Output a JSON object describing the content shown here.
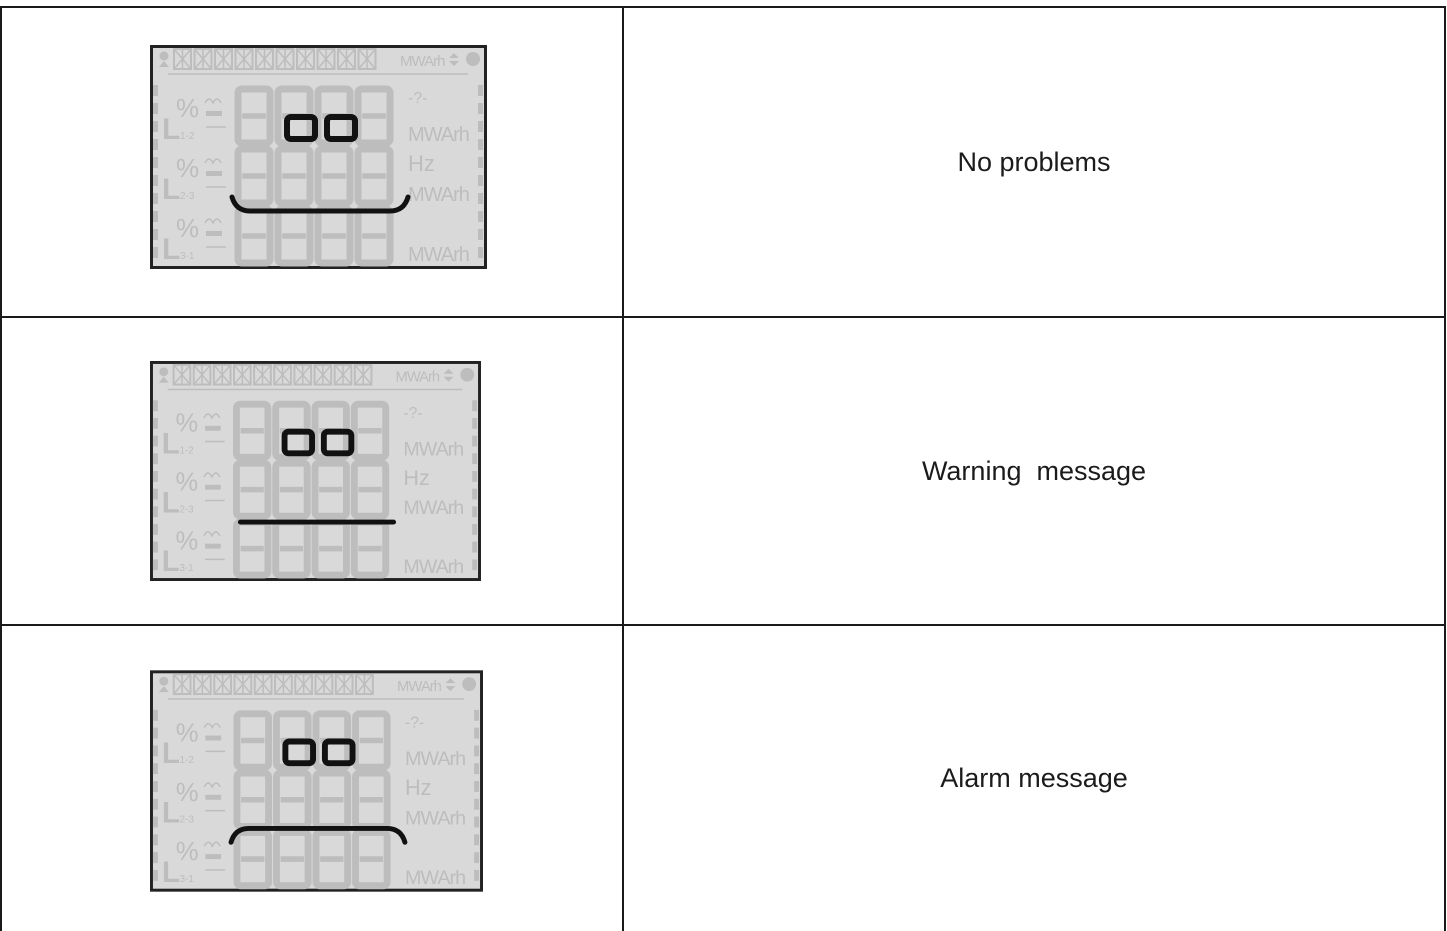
{
  "rows": [
    {
      "lcd": {
        "name": "lcd-display-happy-face",
        "face": "smile",
        "unit_top": "MWArh",
        "hz": "Hz",
        "unit_rows": [
          "MWArh",
          "MWArh",
          "MWArh"
        ],
        "phase_labels": [
          "L1-2",
          "L2-3",
          "L3-1"
        ],
        "percent": "%",
        "question": "-?-"
      },
      "label": "No problems"
    },
    {
      "lcd": {
        "name": "lcd-display-neutral-face",
        "face": "flat",
        "unit_top": "MWArh",
        "hz": "Hz",
        "unit_rows": [
          "MWArh",
          "MWArh",
          "MWArh"
        ],
        "phase_labels": [
          "L1-2",
          "L2-3",
          "L3-1"
        ],
        "percent": "%",
        "question": "-?-"
      },
      "label": "Warning  message"
    },
    {
      "lcd": {
        "name": "lcd-display-sad-face",
        "face": "frown",
        "unit_top": "MWArh",
        "hz": "Hz",
        "unit_rows": [
          "MWArh",
          "MWArh",
          "MWArh"
        ],
        "phase_labels": [
          "L1-2",
          "L2-3",
          "L3-1"
        ],
        "percent": "%",
        "question": "-?-"
      },
      "label": "Alarm message"
    }
  ],
  "colors": {
    "lcd_background": "#d9d9d9",
    "lcd_ghost_segment": "#bdbdbd",
    "lcd_active_segment": "#111111",
    "border": "#1a1a1a"
  }
}
